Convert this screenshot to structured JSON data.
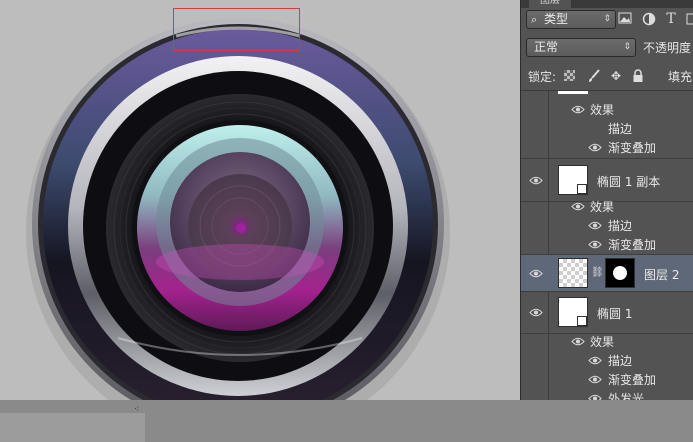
{
  "panel": {
    "tab_title": "图层",
    "filter": {
      "label": "类型"
    },
    "blend_mode": "正常",
    "opacity_label": "不透明度",
    "lock_label": "锁定:",
    "fill_label": "填充"
  },
  "layers": {
    "top_effects_label": "效果",
    "top_stroke_label": "描边",
    "top_gradient_label": "渐变叠加",
    "ellipse1_copy": {
      "name": "椭圆 1 副本",
      "effects_label": "效果",
      "stroke_label": "描边",
      "gradient_label": "渐变叠加"
    },
    "layer2": {
      "name": "图层 2"
    },
    "ellipse1": {
      "name": "椭圆 1",
      "effects_label": "效果",
      "stroke_label": "描边",
      "gradient_label": "渐变叠加",
      "outer_glow_label": "外发光"
    }
  },
  "colors": {
    "canvas_bg": "#bdbdbd",
    "panel_bg": "#535353",
    "selected_layer": "#5e6878",
    "selection_rect": "#d93a3a",
    "lens_purple": "#9a2a86",
    "lens_cyan": "#a8e0dc"
  }
}
